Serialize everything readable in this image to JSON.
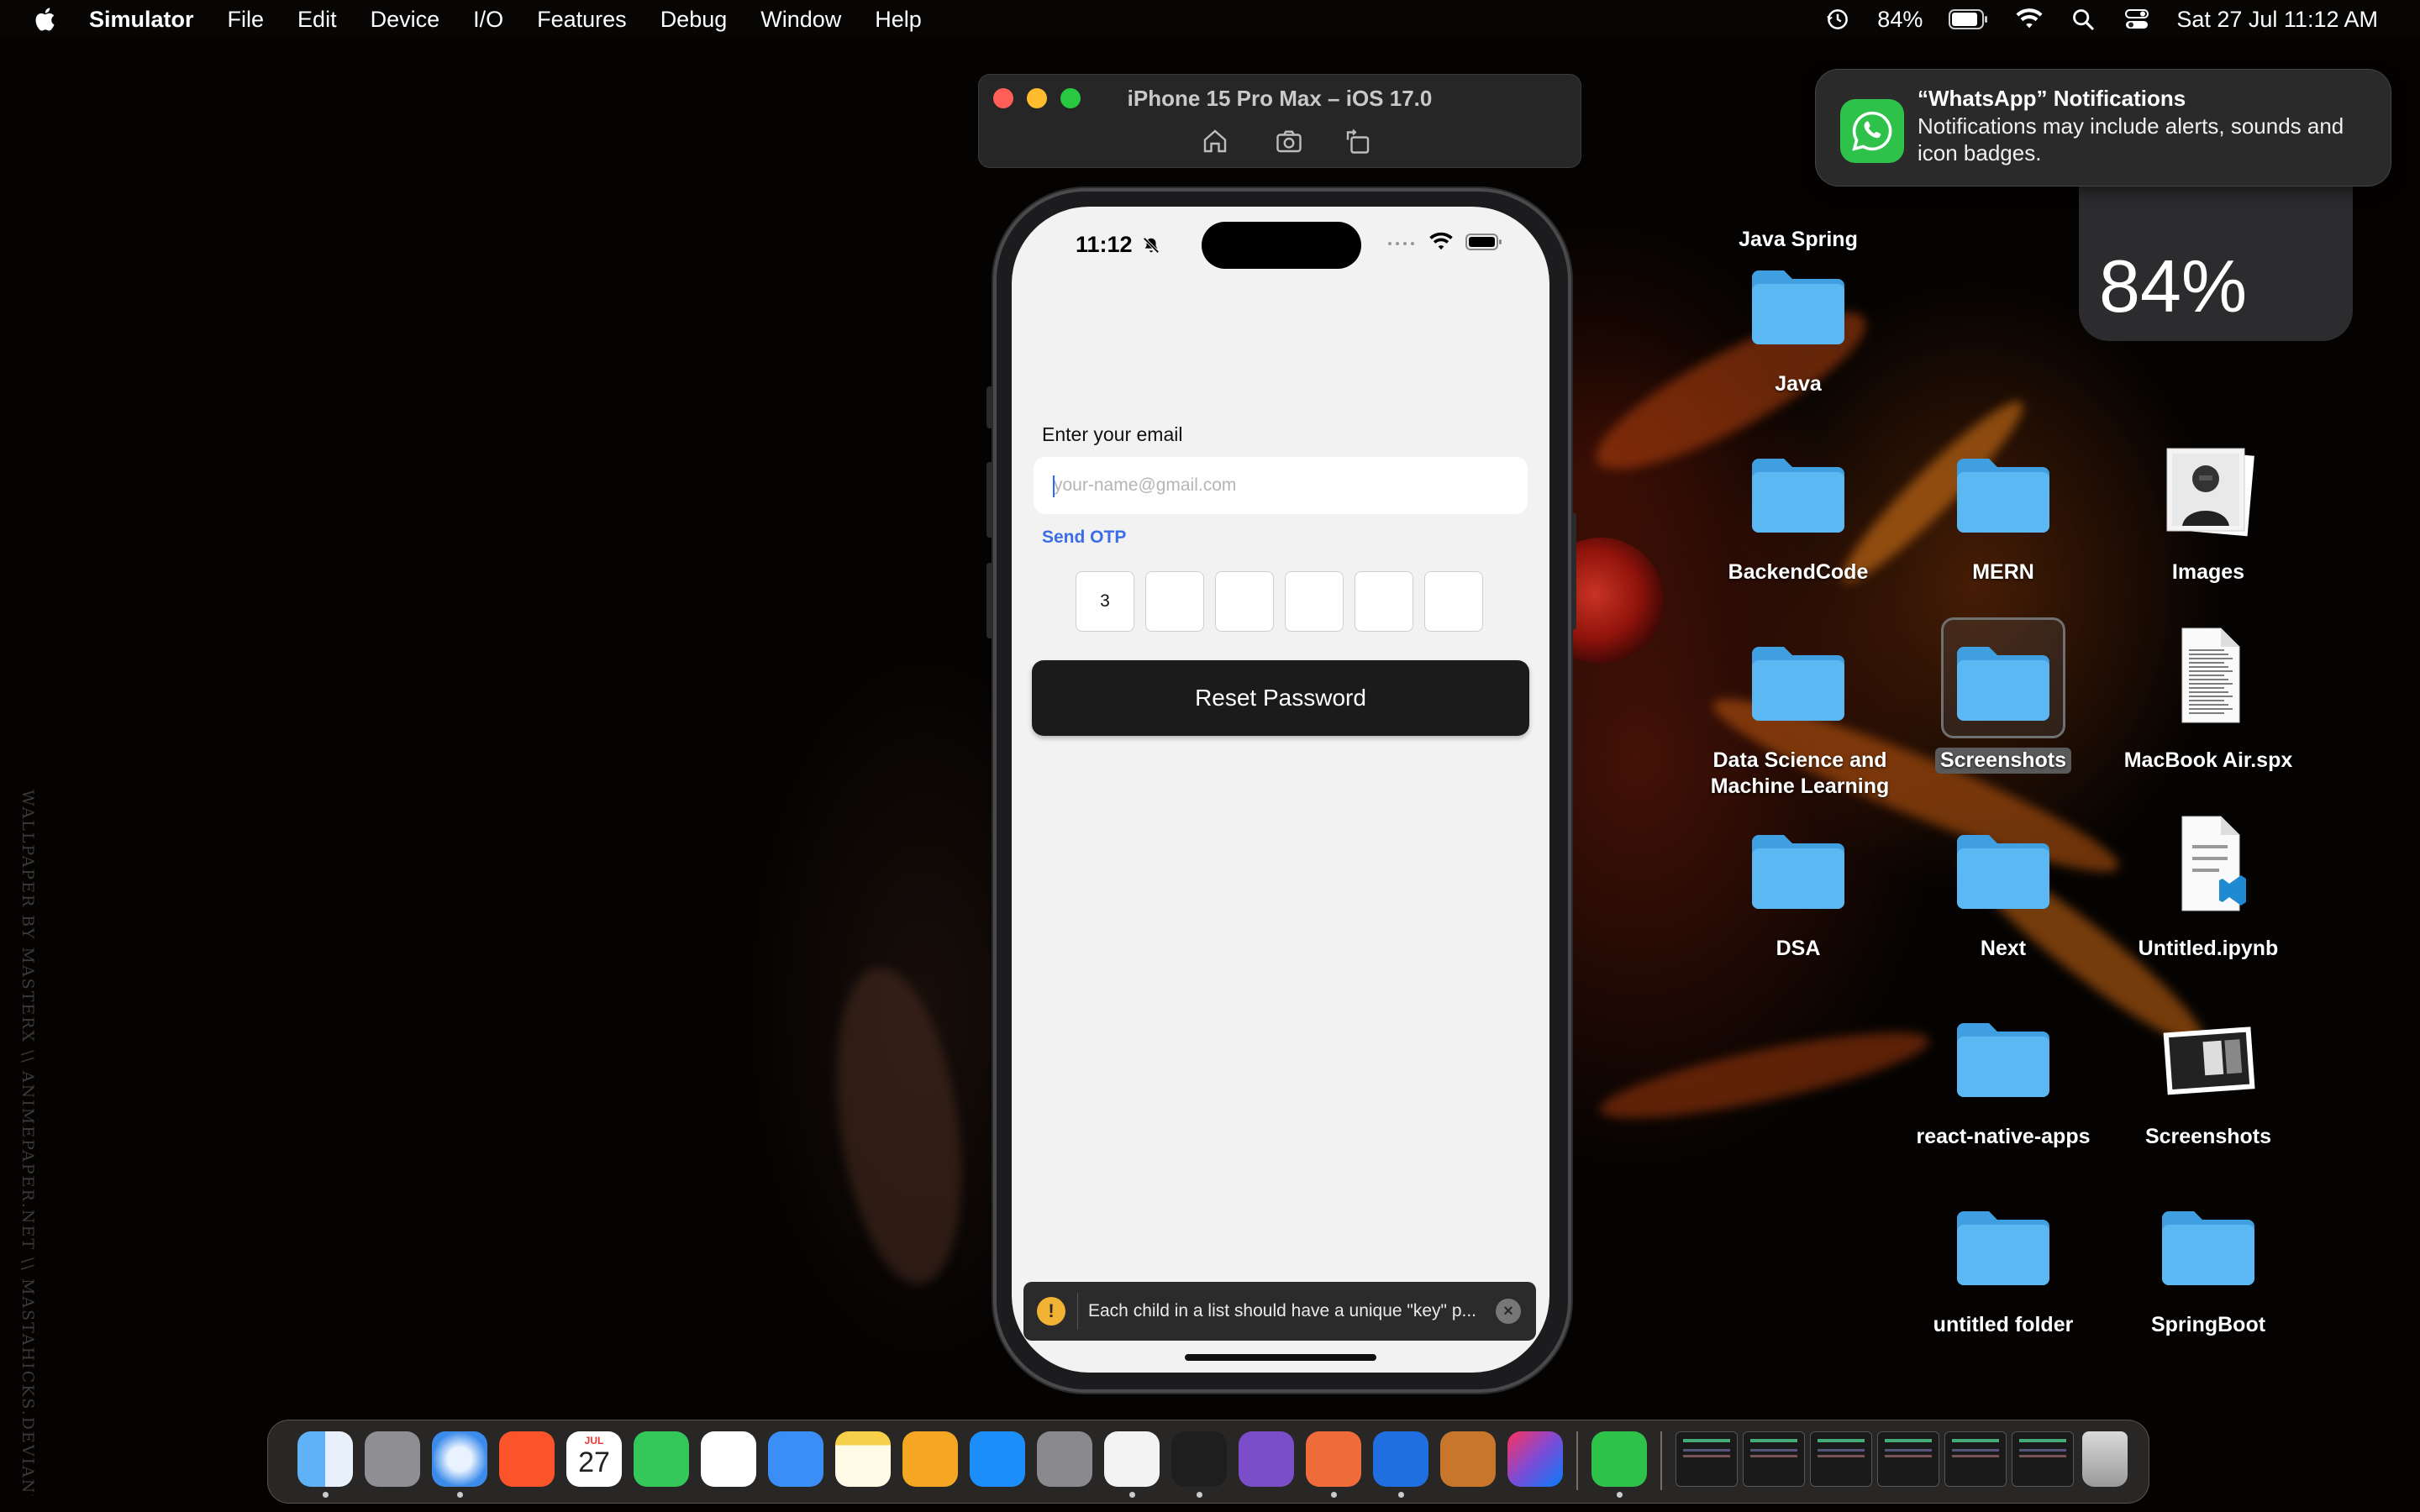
{
  "menubar": {
    "app_name": "Simulator",
    "menus": [
      "File",
      "Edit",
      "Device",
      "I/O",
      "Features",
      "Debug",
      "Window",
      "Help"
    ],
    "battery_percent": "84%",
    "datetime": "Sat 27 Jul  11:12 AM"
  },
  "simulator": {
    "title": "iPhone 15 Pro Max – iOS 17.0",
    "tools": [
      "home-icon",
      "screenshot-icon",
      "rotate-icon"
    ]
  },
  "phone": {
    "status_time": "11:12",
    "email_label": "Enter your email",
    "email_value": "",
    "email_placeholder": "your-name@gmail.com",
    "send_otp_label": "Send OTP",
    "otp_digits": [
      "3",
      "",
      "",
      "",
      "",
      ""
    ],
    "reset_button_label": "Reset Password",
    "warning_text": "Each child in a list should have a unique \"key\" p..."
  },
  "notification": {
    "title": "“WhatsApp” Notifications",
    "body": "Notifications may include alerts, sounds and icon badges.",
    "icon": "whatsapp-icon"
  },
  "battery_widget": {
    "value": "84%"
  },
  "desktop_items": [
    {
      "label": "Java Spring",
      "kind": "folder"
    },
    {
      "label": "Java",
      "kind": "folder"
    },
    {
      "label": "BackendCode",
      "kind": "folder"
    },
    {
      "label": "MERN",
      "kind": "folder"
    },
    {
      "label": "Images",
      "kind": "image"
    },
    {
      "label": "Data Science and Machine Learning",
      "kind": "folder"
    },
    {
      "label": "Screenshots",
      "kind": "folder",
      "selected": true
    },
    {
      "label": "MacBook Air.spx",
      "kind": "document"
    },
    {
      "label": "DSA",
      "kind": "folder"
    },
    {
      "label": "Next",
      "kind": "folder"
    },
    {
      "label": "Untitled.ipynb",
      "kind": "notebook"
    },
    {
      "label": "react-native-apps",
      "kind": "folder"
    },
    {
      "label": "Screenshots",
      "kind": "image"
    },
    {
      "label": "untitled folder",
      "kind": "folder"
    },
    {
      "label": "SpringBoot",
      "kind": "folder"
    }
  ],
  "dock": {
    "apps": [
      "finder-icon",
      "launchpad-icon",
      "safari-icon",
      "brave-icon",
      "calendar-icon",
      "facetime-icon",
      "reminders-icon",
      "mail-icon",
      "notes-icon",
      "pages-icon",
      "app-store-icon",
      "system-settings-icon",
      "vscode-icon",
      "terminal-icon",
      "github-desktop-icon",
      "postman-icon",
      "xcode-icon",
      "reeder-icon",
      "intellij-icon",
      "whatsapp-icon"
    ],
    "calendar_month": "JUL",
    "calendar_day": "27"
  },
  "wallpaper_credit": "WALLPAPER BY MASTERX \\\\ ANIMEPAPER.NET \\\\ MASTAHICKS.DEVIANTART.COM",
  "colors": {
    "folder_blue": "#5cb8f2",
    "send_otp_blue": "#3b6ee6",
    "button_dark": "#1b1b1b",
    "whatsapp_green": "#2fc24b",
    "warning_yellow": "#f2b233"
  }
}
